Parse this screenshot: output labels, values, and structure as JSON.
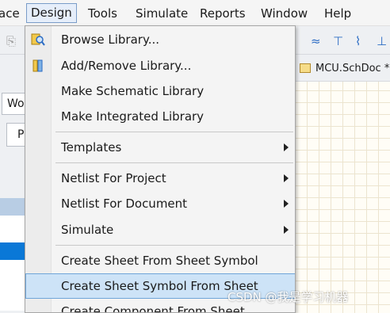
{
  "menubar": {
    "items": [
      {
        "label": "ace"
      },
      {
        "label": "Design"
      },
      {
        "label": "Tools"
      },
      {
        "label": "Simulate"
      },
      {
        "label": "Reports"
      },
      {
        "label": "Window"
      },
      {
        "label": "Help"
      }
    ]
  },
  "background": {
    "left_box1": "Wo",
    "left_box2": "P",
    "doc_tab": "MCU.SchDoc *"
  },
  "design_menu": {
    "items": [
      {
        "label": "Browse Library...",
        "icon": "browse-library-icon"
      },
      {
        "label": "Add/Remove Library...",
        "icon": "library-icon"
      },
      {
        "label": "Make Schematic Library"
      },
      {
        "label": "Make Integrated Library"
      },
      {
        "label": "Templates",
        "submenu": true
      },
      {
        "label": "Netlist For Project",
        "submenu": true
      },
      {
        "label": "Netlist For Document",
        "submenu": true
      },
      {
        "label": "Simulate",
        "submenu": true
      },
      {
        "label": "Create Sheet From Sheet Symbol"
      },
      {
        "label": "Create Sheet Symbol From Sheet",
        "highlighted": true
      },
      {
        "label": "Create Component From Sheet"
      }
    ]
  },
  "watermark": "CSDN @我是学习机器"
}
